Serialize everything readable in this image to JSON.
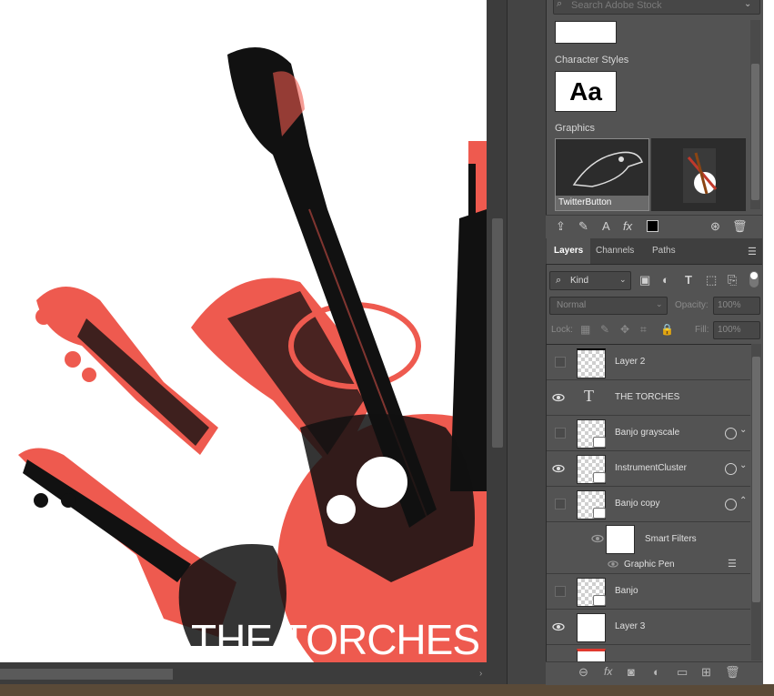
{
  "canvas": {
    "title_text": "THE TORCHES"
  },
  "library": {
    "search_placeholder": "Search Adobe Stock",
    "character_styles_label": "Character Styles",
    "character_style_sample": "Aa",
    "graphics_label": "Graphics",
    "graphics": [
      {
        "label": "TwitterButton"
      },
      {
        "label": ""
      }
    ]
  },
  "tabs": [
    {
      "label": "Layers",
      "active": true
    },
    {
      "label": "Channels"
    },
    {
      "label": "Paths"
    }
  ],
  "filter": {
    "kind_label": "Kind"
  },
  "blend": {
    "mode": "Normal",
    "opacity_label": "Opacity:",
    "opacity_value": "100%"
  },
  "lock": {
    "label": "Lock:",
    "fill_label": "Fill:",
    "fill_value": "100%"
  },
  "layers": [
    {
      "name": "Layer 2",
      "visible": false
    },
    {
      "name": "THE TORCHES",
      "visible": true,
      "type": "text"
    },
    {
      "name": "Banjo grayscale",
      "visible": false
    },
    {
      "name": "InstrumentCluster",
      "visible": true
    },
    {
      "name": "Banjo copy",
      "visible": false
    },
    {
      "name": "Smart Filters"
    },
    {
      "name": "Graphic Pen"
    },
    {
      "name": "Banjo",
      "visible": false
    },
    {
      "name": "Layer 3",
      "visible": true
    }
  ],
  "icons": {
    "eye": "eye-icon",
    "text": "text-layer-icon",
    "search": "search-icon"
  }
}
